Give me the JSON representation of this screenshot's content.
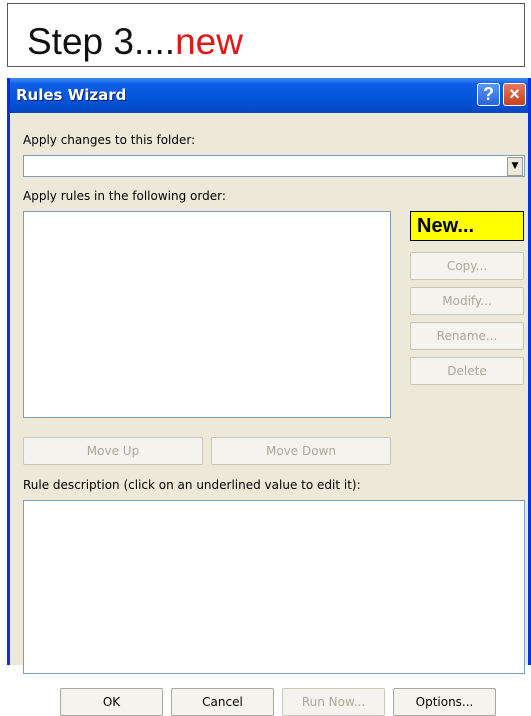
{
  "caption": {
    "text": "Step 3....",
    "accent": "new",
    "accent_color": "#e01818"
  },
  "dialog": {
    "title": "Rules Wizard",
    "help_label": "?",
    "close_label": "×",
    "folder_label": "Apply changes to this folder:",
    "folder_value": "",
    "order_label": "Apply rules in the following order:",
    "side_buttons": {
      "new": "New...",
      "copy": "Copy...",
      "modify": "Modify...",
      "rename": "Rename...",
      "delete": "Delete"
    },
    "move_up": "Move Up",
    "move_down": "Move Down",
    "description_label": "Rule description (click on an underlined value to edit it):",
    "footer_buttons": {
      "ok": "OK",
      "cancel": "Cancel",
      "run_now": "Run Now...",
      "options": "Options..."
    },
    "colors": {
      "title_bar": "#0455d9",
      "highlight": "#ffff00",
      "dialog_bg": "#ece9d8"
    }
  }
}
